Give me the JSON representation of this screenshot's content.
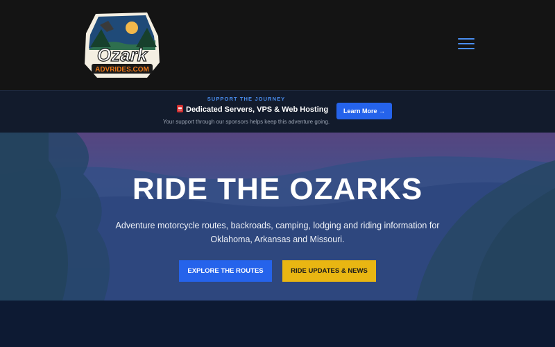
{
  "header": {
    "logo": {
      "line1": "Ozark",
      "line2": "ADVRIDES.COM"
    },
    "menu_icon": "hamburger-menu-icon"
  },
  "sponsor": {
    "kicker": "SUPPORT THE JOURNEY",
    "title": "Dedicated Servers, VPS & Web Hosting",
    "subtitle": "Your support through our sponsors helps keep this adventure going.",
    "button_label": "Learn More →"
  },
  "hero": {
    "title": "RIDE THE OZARKS",
    "description": "Adventure motorcycle routes, backroads, camping, lodging and riding information for Oklahoma, Arkansas and Missouri.",
    "explore_label": "EXPLORE THE ROUTES",
    "updates_label": "RIDE UPDATES & NEWS"
  },
  "colors": {
    "accent_blue": "#2563eb",
    "accent_yellow": "#e9b612",
    "topbar": "#141414",
    "page_bg": "#0d1a33"
  }
}
